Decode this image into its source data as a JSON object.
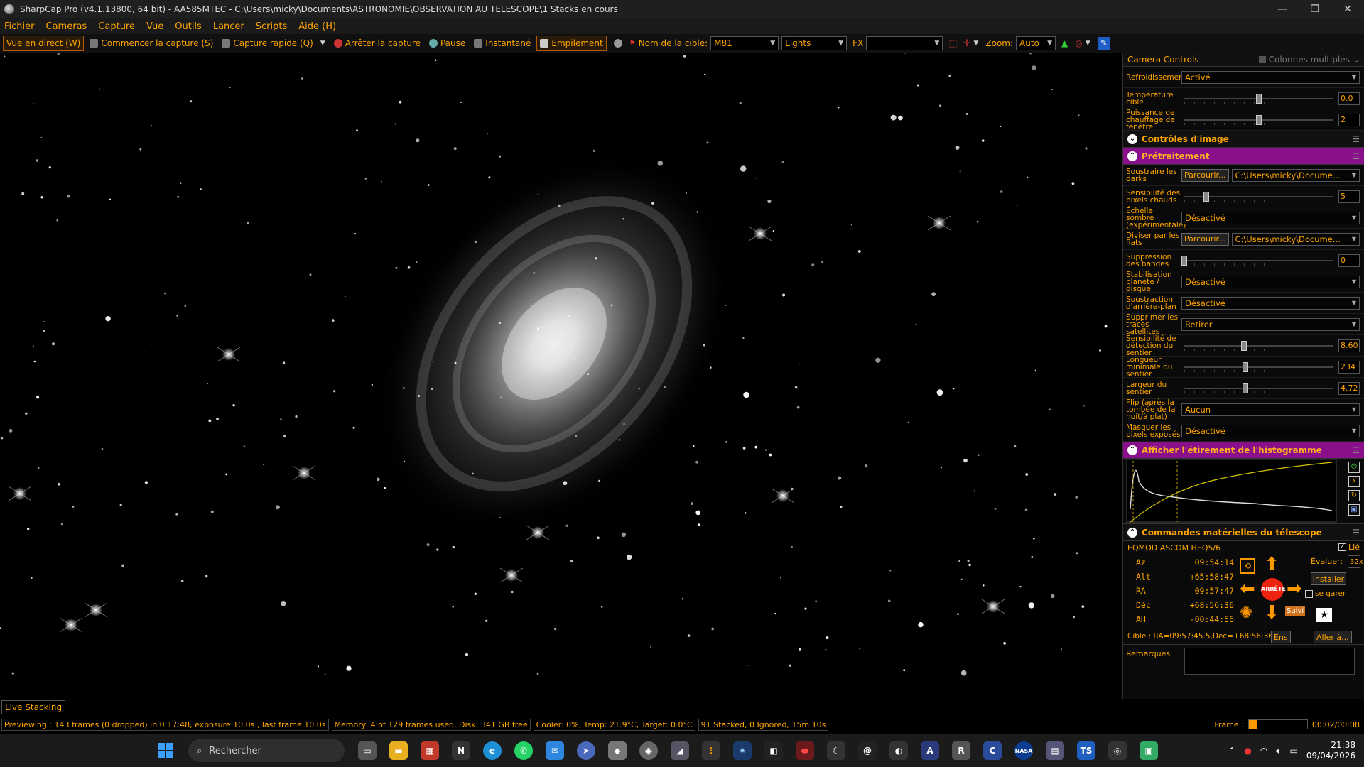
{
  "window": {
    "title": "SharpCap Pro (v4.1.13800, 64 bit) - AA585MTEC - C:\\Users\\micky\\Documents\\ASTRONOMIE\\OBSERVATION AU TELESCOPE\\1 Stacks en cours"
  },
  "menu": [
    "Fichier",
    "Cameras",
    "Capture",
    "Vue",
    "Outils",
    "Lancer",
    "Scripts",
    "Aide (H)"
  ],
  "toolbar": {
    "live_view": "Vue en direct (W)",
    "start_capture": "Commencer la capture (S)",
    "quick_capture": "Capture rapide (Q)",
    "stop_capture": "Arrêter la capture",
    "pause": "Pause",
    "snapshot": "Instantané",
    "stacking": "Empilement",
    "target_label": "Nom de la cible:",
    "target_value": "M81",
    "frame_type": "Lights",
    "fx_label": "FX",
    "fx_value": "",
    "zoom_label": "Zoom:",
    "zoom_value": "Auto"
  },
  "panel": {
    "header": "Camera Controls",
    "multi_columns": "Colonnes multiples",
    "cooling": {
      "label": "Refroidissement",
      "value": "Activé"
    },
    "target_temp": {
      "label": "Température cible",
      "value": "0.0",
      "level": 0.5
    },
    "heater": {
      "label": "Puissance de chauffage de fenêtre",
      "value": "2",
      "level": 0.5
    },
    "sections": {
      "image_controls": "Contrôles d'image",
      "preprocessing": "Prétraitement",
      "histogram": "Afficher l'étirement de l'histogramme",
      "telescope": "Commandes matérielles du télescope"
    },
    "darks": {
      "label": "Soustraire les darks",
      "browse": "Parcourir...",
      "path": "C:\\Users\\micky\\Docume..."
    },
    "hot_pixels": {
      "label": "Sensibilité des pixels chauds",
      "value": "5",
      "level": 0.15
    },
    "dark_scale": {
      "label": "Échelle sombre (expérimentale)",
      "value": "Désactivé"
    },
    "flats": {
      "label": "Diviser par les flats",
      "browse": "Parcourir...",
      "path": "C:\\Users\\micky\\Docume..."
    },
    "banding": {
      "label": "Suppression des bandes",
      "value": "0",
      "level": 0.0
    },
    "stabilize": {
      "label": "Stabilisation planète / disque",
      "value": "Désactivé"
    },
    "background": {
      "label": "Soustraction d'arrière-plan",
      "value": "Désactivé"
    },
    "satellites": {
      "label": "Supprimer les traces satellites",
      "value": "Retirer"
    },
    "trail_sens": {
      "label": "Sensibilité de détection du sentier",
      "value": "8.60",
      "level": 0.4
    },
    "trail_len": {
      "label": "Longueur minimale du sentier",
      "value": "234",
      "level": 0.41
    },
    "trail_width": {
      "label": "Largeur du sentier",
      "value": "4.72",
      "level": 0.41
    },
    "flip": {
      "label": "Flip (après la tombée de la nuit/à plat)",
      "value": "Aucun"
    },
    "mask": {
      "label": "Masquer les pixels exposés",
      "value": "Désactivé"
    },
    "mount": {
      "name": "EQMOD ASCOM HEQ5/6",
      "linked": "Lié",
      "az_label": "Az",
      "az": "09:54:14",
      "alt_label": "Alt",
      "alt": "+65:58:47",
      "ra_label": "RA",
      "ra": "09:57:47",
      "dec_label": "Déc",
      "dec": "+68:56:36",
      "ah_label": "AH",
      "ah": "-00:44:56",
      "rate_label": "Évaluer:",
      "rate": "32x",
      "install": "Installer",
      "park": "se garer",
      "stop": "ARRÊTE",
      "track": "Suivi",
      "target": "Cible : RA=09:57:45.5,Dec=+68:56:36",
      "ens": "Ens",
      "goto": "Aller à..."
    },
    "notes": "Remarques"
  },
  "live_stacking": "Live Stacking",
  "status": {
    "preview": "Previewing : 143 frames (0 dropped) in 0:17:48, exposure 10.0s , last frame 10.0s",
    "memory": "Memory: 4 of 129 frames used, Disk: 341 GB free",
    "cooler": "Cooler: 0%, Temp: 21.9°C, Target: 0.0°C",
    "stacked": "91 Stacked, 0 Ignored, 15m 10s",
    "frame_label": "Frame :",
    "frame_value": "00:02/00:08"
  },
  "taskbar": {
    "search": "Rechercher",
    "time": "21:38",
    "date": "09/04/2026"
  }
}
